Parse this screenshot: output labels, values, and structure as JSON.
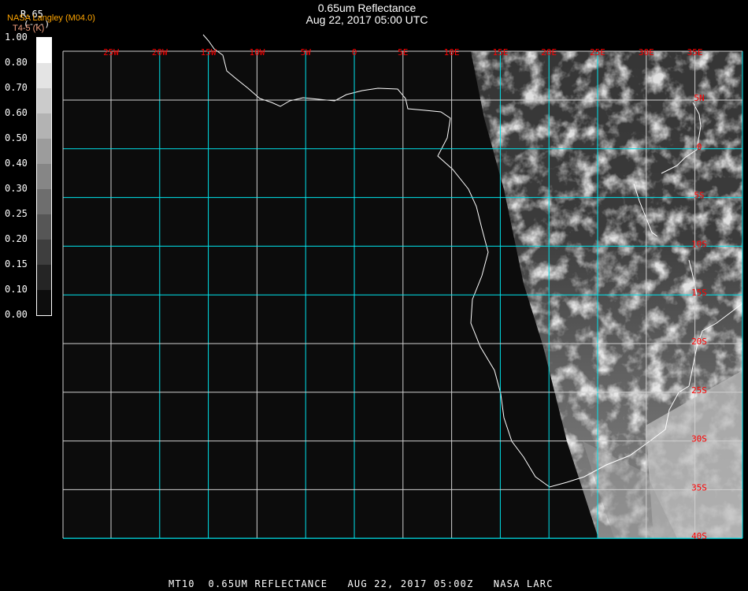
{
  "header": {
    "title": "0.65um Reflectance",
    "datetime": "Aug 22, 2017 05:00 UTC",
    "product": "R.65",
    "units": "(---)",
    "source": "NASA Langley (M04.0)",
    "overlay": "T4-5 (K)"
  },
  "colorbar": {
    "labels": [
      "1.00",
      "0.80",
      "0.70",
      "0.60",
      "0.50",
      "0.40",
      "0.30",
      "0.25",
      "0.20",
      "0.15",
      "0.10",
      "0.00"
    ],
    "colors": [
      "#ffffff",
      "#e4e4e4",
      "#cbcbcb",
      "#b3b3b3",
      "#9c9c9c",
      "#868686",
      "#6e6e6e",
      "#565656",
      "#3e3e3e",
      "#252525",
      "#0d0d0d"
    ]
  },
  "map": {
    "lon_labels": [
      "25W",
      "20W",
      "15W",
      "10W",
      "5W",
      "0",
      "5E",
      "10E",
      "15E",
      "20E",
      "25E",
      "30E",
      "35E"
    ],
    "lat_labels": [
      "5N",
      "0",
      "5S",
      "10S",
      "15S",
      "20S",
      "25S",
      "30S",
      "35S",
      "40S"
    ],
    "grid_color": "#00e5ee",
    "label_color": "#ff0000"
  },
  "footer": {
    "text": "MT10  0.65UM REFLECTANCE   AUG 22, 2017 05:00Z   NASA LARC"
  }
}
